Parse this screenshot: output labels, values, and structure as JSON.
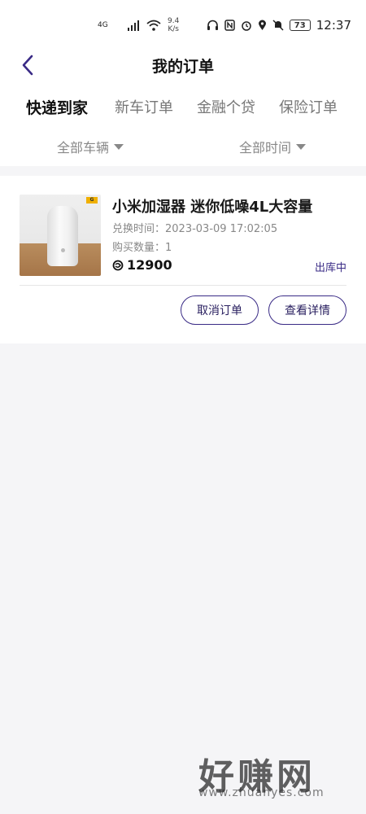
{
  "statusbar": {
    "network": "4G",
    "speed_value": "9.4",
    "speed_unit": "K/s",
    "battery": "73",
    "time": "12:37"
  },
  "header": {
    "title": "我的订单"
  },
  "tabs": {
    "partial_left": "",
    "items": [
      "快递到家",
      "新车订单",
      "金融个贷",
      "保险订单"
    ],
    "partial_right": "",
    "active_index": 0,
    "accent_color": "#d6f000"
  },
  "filters": {
    "vehicle": "全部车辆",
    "time": "全部时间"
  },
  "order": {
    "product_name": "小米加湿器 迷你低噪4L大容量",
    "redeem_time_label": "兑换时间：",
    "redeem_time": "2023-03-09 17:02:05",
    "quantity_label": "购买数量：",
    "quantity": "1",
    "points": "12900",
    "status": "出库中",
    "status_color": "#3a2b86",
    "cancel_label": "取消订单",
    "detail_label": "查看详情"
  },
  "watermark": {
    "text": "好赚网",
    "url": "www.zhuanyes.com"
  }
}
